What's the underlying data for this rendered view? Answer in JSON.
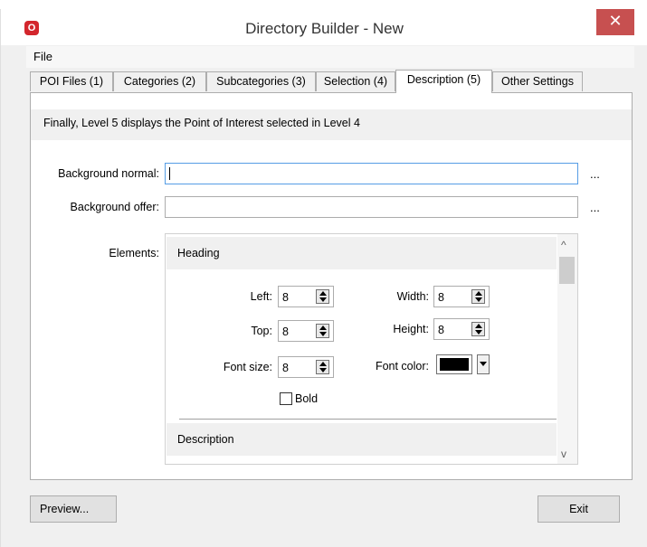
{
  "window": {
    "title": "Directory Builder - New",
    "close_label": "✕",
    "app_icon_letter": "O"
  },
  "menu": {
    "file": "File"
  },
  "tabs": [
    {
      "label": "POI Files (1)"
    },
    {
      "label": "Categories (2)"
    },
    {
      "label": "Subcategories (3)"
    },
    {
      "label": "Selection (4)"
    },
    {
      "label": "Description (5)",
      "active": true
    },
    {
      "label": "Other Settings"
    }
  ],
  "info": "Finally, Level 5 displays the Point of Interest selected in Level 4",
  "background_normal": {
    "label": "Background normal:",
    "value": "",
    "browse": "..."
  },
  "background_offer": {
    "label": "Background offer:",
    "value": "",
    "browse": "..."
  },
  "elements": {
    "label": "Elements:",
    "heading_section": "Heading",
    "left": {
      "label": "Left:",
      "value": "8"
    },
    "width": {
      "label": "Width:",
      "value": "8"
    },
    "top": {
      "label": "Top:",
      "value": "8"
    },
    "height": {
      "label": "Height:",
      "value": "8"
    },
    "font_size": {
      "label": "Font size:",
      "value": "8"
    },
    "font_color": {
      "label": "Font color:",
      "color": "#000000"
    },
    "bold": {
      "label": "Bold",
      "checked": false
    },
    "description_section": "Description",
    "scroll_up": "^",
    "scroll_down": "v"
  },
  "buttons": {
    "preview": "Preview...",
    "exit": "Exit"
  },
  "colors": {
    "close": "#c75050",
    "focus_border": "#569de5",
    "icon": "#d3262d"
  }
}
